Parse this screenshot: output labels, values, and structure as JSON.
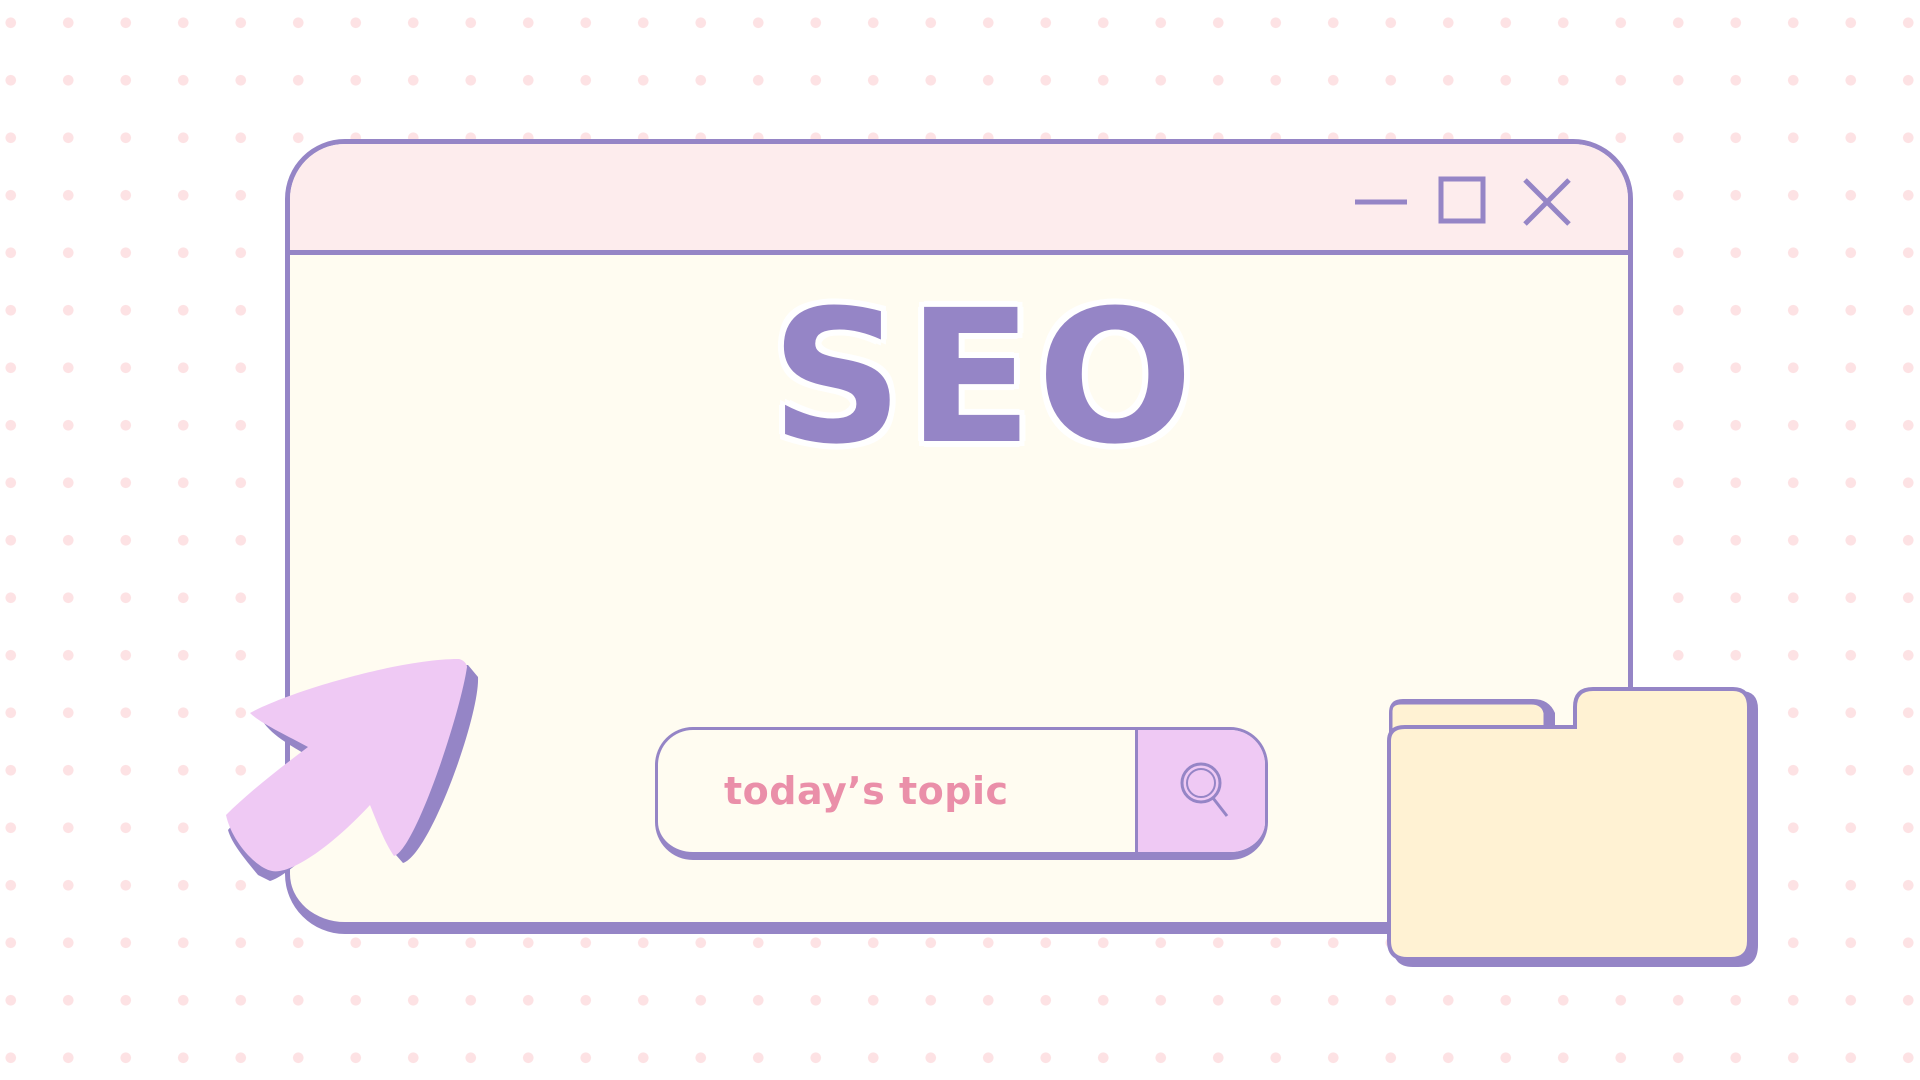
{
  "window": {
    "controls": {
      "minimize_icon": "minimize-icon",
      "maximize_icon": "maximize-icon",
      "close_icon": "close-icon"
    }
  },
  "headline": "SEO",
  "search": {
    "value": "today’s topic",
    "button_icon": "search-icon"
  },
  "decorations": {
    "cursor_icon": "cursor-arrow-icon",
    "folder_icon": "folder-icon"
  },
  "colors": {
    "accent_purple": "#9585c6",
    "titlebar_pink": "#fdeced",
    "window_cream": "#fffcf1",
    "search_button_lilac": "#efc9f4",
    "text_pink": "#ea8fa9",
    "folder_yellow": "#fff2d3",
    "dot_pink": "#fde2e4"
  }
}
